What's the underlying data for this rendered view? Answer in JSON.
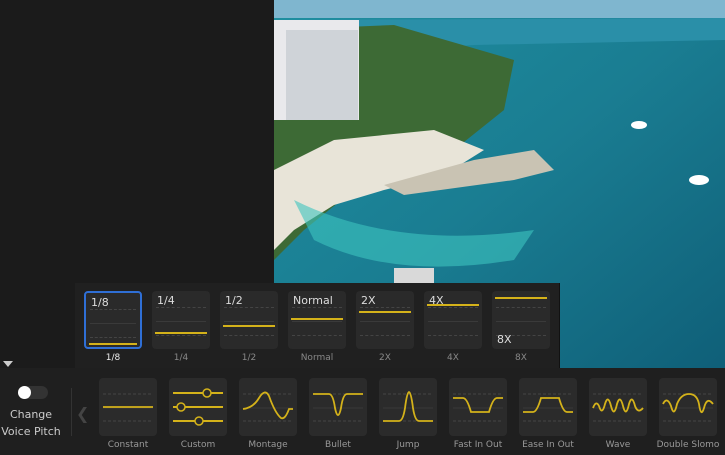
{
  "speed_options": [
    {
      "label": "1/8",
      "card_text": "1/8",
      "level": 0.05,
      "selected": true
    },
    {
      "label": "1/4",
      "card_text": "1/4",
      "level": 0.25,
      "selected": false
    },
    {
      "label": "1/2",
      "card_text": "1/2",
      "level": 0.4,
      "selected": false
    },
    {
      "label": "Normal",
      "card_text": "Normal",
      "level": 0.55,
      "selected": false
    },
    {
      "label": "2X",
      "card_text": "2X",
      "level": 0.7,
      "selected": false
    },
    {
      "label": "4X",
      "card_text": "4X",
      "level": 0.85,
      "selected": false
    },
    {
      "label": "8X",
      "card_text": "8X",
      "level": 1.0,
      "selected": false
    }
  ],
  "voice_pitch": {
    "label_line1": "Change",
    "label_line2": "Voice Pitch",
    "enabled": false
  },
  "curves": [
    {
      "label": "Constant",
      "icon": "constant-curve-icon"
    },
    {
      "label": "Custom",
      "icon": "custom-sliders-icon"
    },
    {
      "label": "Montage",
      "icon": "montage-curve-icon"
    },
    {
      "label": "Bullet",
      "icon": "bullet-curve-icon"
    },
    {
      "label": "Jump",
      "icon": "jump-curve-icon"
    },
    {
      "label": "Fast In Out",
      "icon": "fast-in-out-curve-icon"
    },
    {
      "label": "Ease In Out",
      "icon": "ease-in-out-curve-icon"
    },
    {
      "label": "Wave",
      "icon": "wave-curve-icon"
    },
    {
      "label": "Double Slomo",
      "icon": "double-slomo-curve-icon"
    }
  ],
  "colors": {
    "accent": "#d4b21a",
    "selected": "#2f6fd6"
  }
}
